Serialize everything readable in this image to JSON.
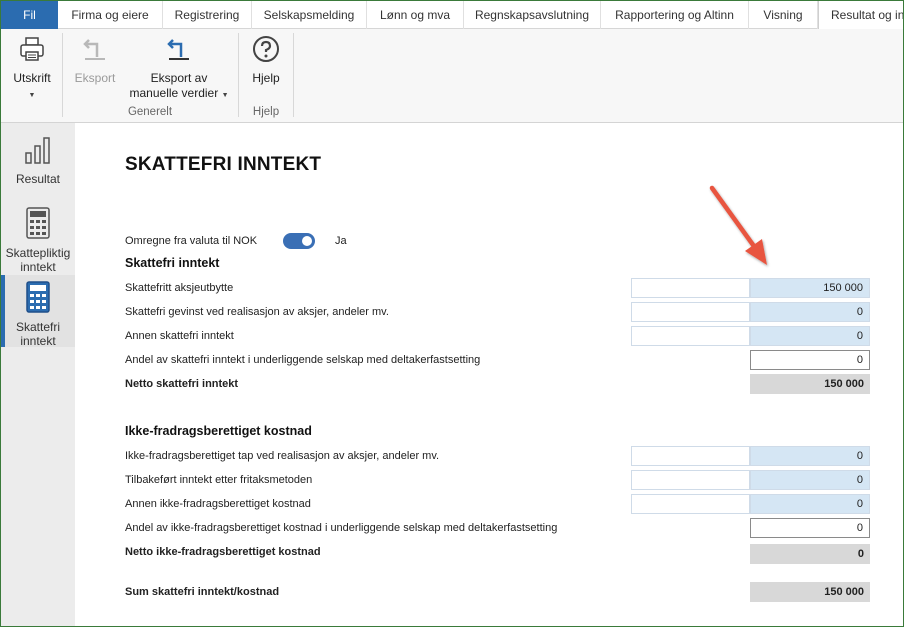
{
  "menu": {
    "tabs": [
      {
        "label": "Fil"
      },
      {
        "label": "Firma og eiere"
      },
      {
        "label": "Registrering"
      },
      {
        "label": "Selskapsmelding"
      },
      {
        "label": "Lønn og mva"
      },
      {
        "label": "Regnskapsavslutning"
      },
      {
        "label": "Rapportering og Altinn"
      },
      {
        "label": "Visning"
      },
      {
        "label": "Resultat og in"
      }
    ]
  },
  "ribbon": {
    "print_label": "Utskrift",
    "export_label": "Eksport",
    "export_manual_label_1": "Eksport av",
    "export_manual_label_2": "manuelle verdier",
    "help_label": "Hjelp",
    "group_general": "Generelt",
    "group_help": "Hjelp",
    "icons": {
      "print": "printer-icon",
      "export": "export-arrow-icon",
      "export_manual": "export-manual-icon",
      "help": "question-icon"
    }
  },
  "sidebar": {
    "items": [
      {
        "label_1": "Resultat",
        "label_2": "",
        "icon": "bar-chart-icon"
      },
      {
        "label_1": "Skattepliktig",
        "label_2": "inntekt",
        "icon": "calculator-icon"
      },
      {
        "label_1": "Skattefri",
        "label_2": "inntekt",
        "icon": "calculator-icon"
      }
    ]
  },
  "page": {
    "title": "SKATTEFRI INNTEKT",
    "currency_toggle_label": "Omregne fra valuta til NOK",
    "currency_toggle_value": "Ja",
    "currency_toggle_on": true
  },
  "section1": {
    "heading": "Skattefri inntekt",
    "rows": [
      {
        "label": "Skattefritt aksjeutbytte",
        "value": "150 000"
      },
      {
        "label": "Skattefri gevinst ved realisasjon av aksjer, andeler mv.",
        "value": "0"
      },
      {
        "label": "Annen skattefri inntekt",
        "value": "0"
      },
      {
        "label": "Andel av skattefri inntekt i underliggende selskap med deltakerfastsetting",
        "value": "0"
      }
    ],
    "total_label": "Netto skattefri inntekt",
    "total_value": "150 000"
  },
  "section2": {
    "heading": "Ikke-fradragsberettiget kostnad",
    "rows": [
      {
        "label": "Ikke-fradragsberettiget tap ved realisasjon av aksjer, andeler mv.",
        "value": "0"
      },
      {
        "label": "Tilbakeført inntekt etter fritaksmetoden",
        "value": "0"
      },
      {
        "label": "Annen ikke-fradragsberettiget kostnad",
        "value": "0"
      },
      {
        "label": "Andel av ikke-fradragsberettiget kostnad i underliggende selskap med deltakerfastsetting",
        "value": "0"
      }
    ],
    "total_label": "Netto ikke-fradragsberettiget kostnad",
    "total_value": "0"
  },
  "summary": {
    "label": "Sum skattefri inntekt/kostnad",
    "value": "150 000"
  },
  "colors": {
    "accent": "#2b6cb0",
    "input_blue": "#d5e6f4",
    "total_gray": "#d8d8d8",
    "annotation_arrow": "#e8543f"
  }
}
